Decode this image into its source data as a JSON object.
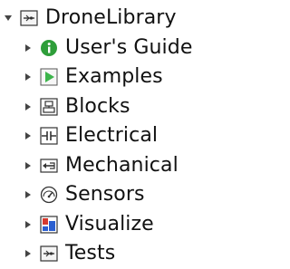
{
  "tree": {
    "root": {
      "label": "DroneLibrary",
      "icon": "library-icon",
      "expanded": true
    },
    "children": [
      {
        "label": "User's Guide",
        "icon": "info-icon",
        "expanded": false
      },
      {
        "label": "Examples",
        "icon": "play-icon",
        "expanded": false
      },
      {
        "label": "Blocks",
        "icon": "blocks-icon",
        "expanded": false
      },
      {
        "label": "Electrical",
        "icon": "electrical-icon",
        "expanded": false
      },
      {
        "label": "Mechanical",
        "icon": "mechanical-icon",
        "expanded": false
      },
      {
        "label": "Sensors",
        "icon": "sensor-gauge-icon",
        "expanded": false
      },
      {
        "label": "Visualize",
        "icon": "visualize-icon",
        "expanded": false
      },
      {
        "label": "Tests",
        "icon": "tests-icon",
        "expanded": false
      }
    ]
  },
  "colors": {
    "text": "#111111",
    "toggle": "#444444",
    "info_green": "#2e9e3a",
    "play_green": "#3cb44b",
    "visualize_blue": "#2b5fd0",
    "visualize_red": "#d63a2f",
    "icon_stroke": "#333333"
  }
}
